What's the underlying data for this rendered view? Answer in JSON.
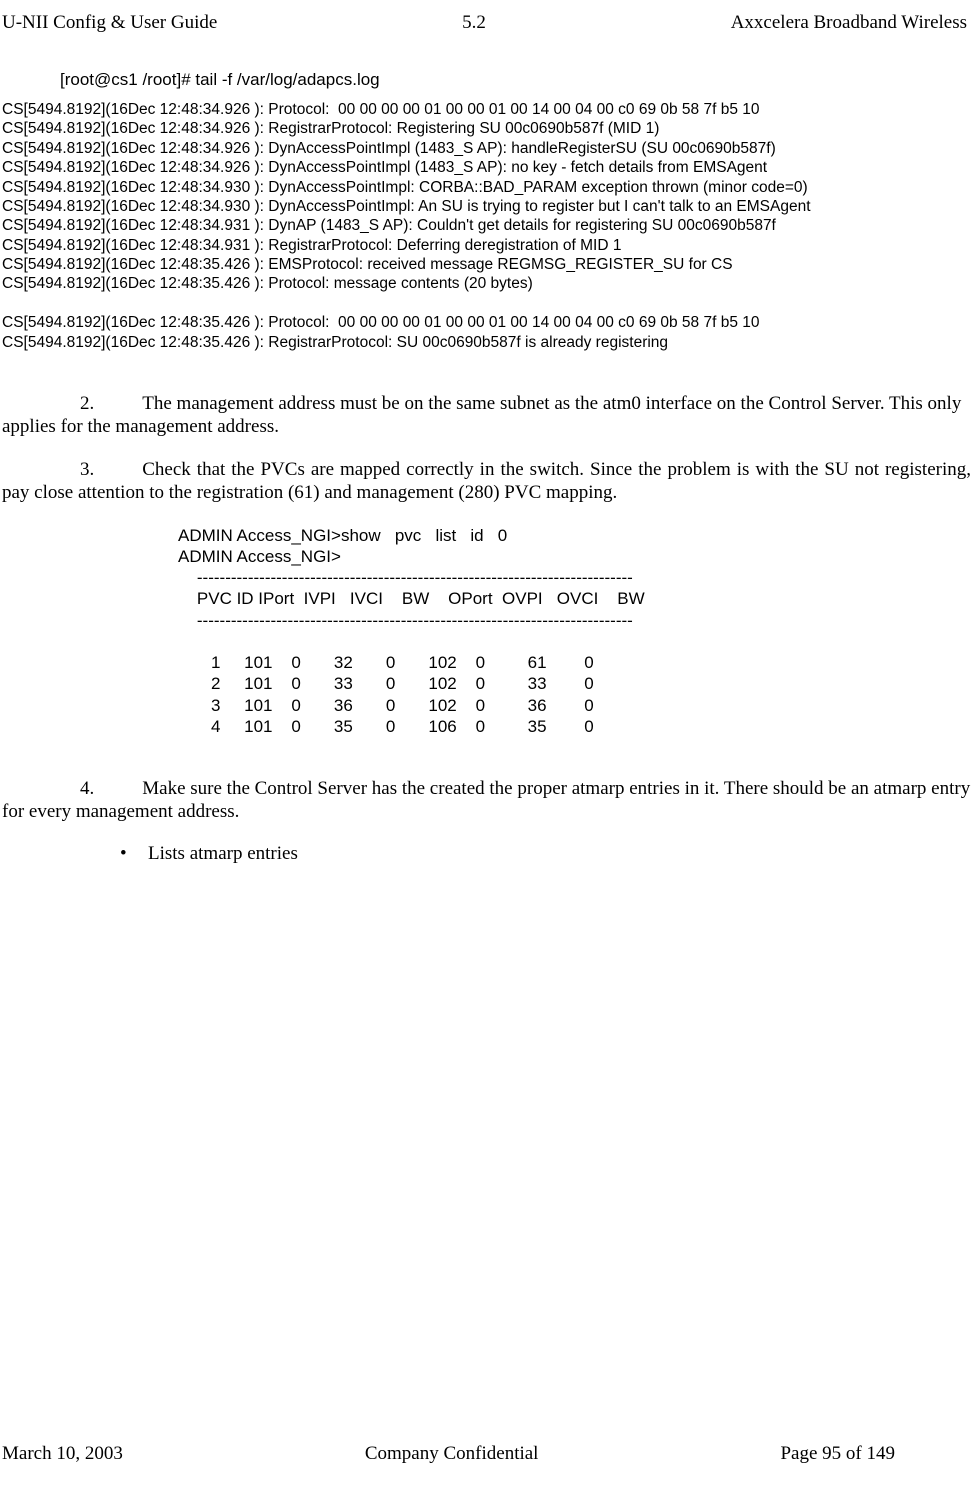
{
  "header": {
    "left": "U-NII Config & User Guide",
    "center": "5.2",
    "right": "Axxcelera Broadband Wireless"
  },
  "cmd": "[root@cs1 /root]#   tail   -f   /var/log/adapcs.log",
  "log": "CS[5494.8192](16Dec 12:48:34.926 ): Protocol:  00 00 00 00 01 00 00 01 00 14 00 04 00 c0 69 0b 58 7f b5 10\nCS[5494.8192](16Dec 12:48:34.926 ): RegistrarProtocol: Registering SU 00c0690b587f (MID 1)\nCS[5494.8192](16Dec 12:48:34.926 ): DynAccessPointImpl (1483_S AP): handleRegisterSU (SU 00c0690b587f)\nCS[5494.8192](16Dec 12:48:34.926 ): DynAccessPointImpl (1483_S AP): no key - fetch details from EMSAgent\nCS[5494.8192](16Dec 12:48:34.930 ): DynAccessPointImpl: CORBA::BAD_PARAM exception thrown (minor code=0)\nCS[5494.8192](16Dec 12:48:34.930 ): DynAccessPointImpl: An SU is trying to register but I can't talk to an EMSAgent\nCS[5494.8192](16Dec 12:48:34.931 ): DynAP (1483_S AP): Couldn't get details for registering SU 00c0690b587f\nCS[5494.8192](16Dec 12:48:34.931 ): RegistrarProtocol: Deferring deregistration of MID 1\nCS[5494.8192](16Dec 12:48:35.426 ): EMSProtocol: received message REGMSG_REGISTER_SU for CS\nCS[5494.8192](16Dec 12:48:35.426 ): Protocol: message contents (20 bytes)\n\nCS[5494.8192](16Dec 12:48:35.426 ): Protocol:  00 00 00 00 01 00 00 01 00 14 00 04 00 c0 69 0b 58 7f b5 10\nCS[5494.8192](16Dec 12:48:35.426 ): RegistrarProtocol: SU 00c0690b587f is already registering",
  "steps": {
    "s2": {
      "num": "2.",
      "text": "The management address must be on the same subnet as the atm0 interface on the Control Server. This only applies for the management address."
    },
    "s3": {
      "num": "3.",
      "text": "Check that the PVCs are mapped correctly in the switch.  Since the problem is with the SU not registering, pay close attention to the registration (61) and management (280) PVC mapping."
    },
    "s4": {
      "num": "4.",
      "text": "Make sure the Control Server has the created the proper atmarp entries in it. There should be an atmarp entry for every management address."
    }
  },
  "pvc": "ADMIN Access_NGI>show   pvc   list   id   0\nADMIN Access_NGI>\n    -----------------------------------------------------------------------------\n    PVC ID IPort  IVPI   IVCI    BW    OPort  OVPI   OVCI    BW\n    -----------------------------------------------------------------------------\n\n       1     101    0       32       0       102    0         61        0\n       2     101    0       33       0       102    0         33        0\n       3     101    0       36       0       102    0         36        0\n       4     101    0       35       0       106    0         35        0",
  "bullet": {
    "text": "Lists atmarp entries"
  },
  "footer": {
    "left": "March 10, 2003",
    "center": "Company Confidential",
    "right": "Page 95 of 149"
  }
}
